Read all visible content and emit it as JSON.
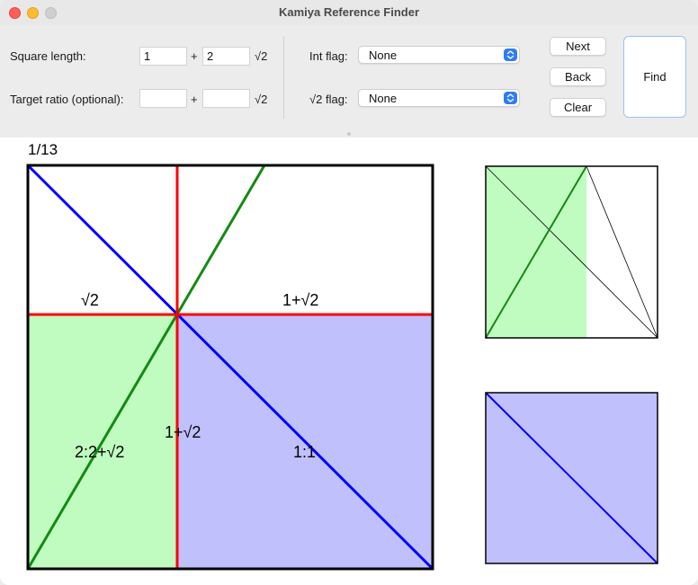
{
  "window": {
    "title": "Kamiya Reference Finder"
  },
  "controls": {
    "square_length_label": "Square length:",
    "square_length_int": "1",
    "square_length_sqrt": "2",
    "target_ratio_label": "Target ratio (optional):",
    "target_ratio_int": "",
    "target_ratio_sqrt": "",
    "plus": "+",
    "sqrt_symbol": "√2",
    "int_flag_label": "Int flag:",
    "int_flag_value": "None",
    "sqrt_flag_label": "√2 flag:",
    "sqrt_flag_value": "None",
    "next_label": "Next",
    "back_label": "Back",
    "clear_label": "Clear",
    "find_label": "Find"
  },
  "result": {
    "counter": "1/13",
    "labels": {
      "top_left": "√2",
      "top_right": "1+√2",
      "vertical": "1+√2",
      "green_ratio": "2:2+√2",
      "blue_ratio": "1:1"
    }
  },
  "colors": {
    "red": "#ff0000",
    "blue": "#0000ff",
    "green": "#138a13",
    "green_fill": "#c0fcc0",
    "blue_fill": "#c0c0fc"
  }
}
